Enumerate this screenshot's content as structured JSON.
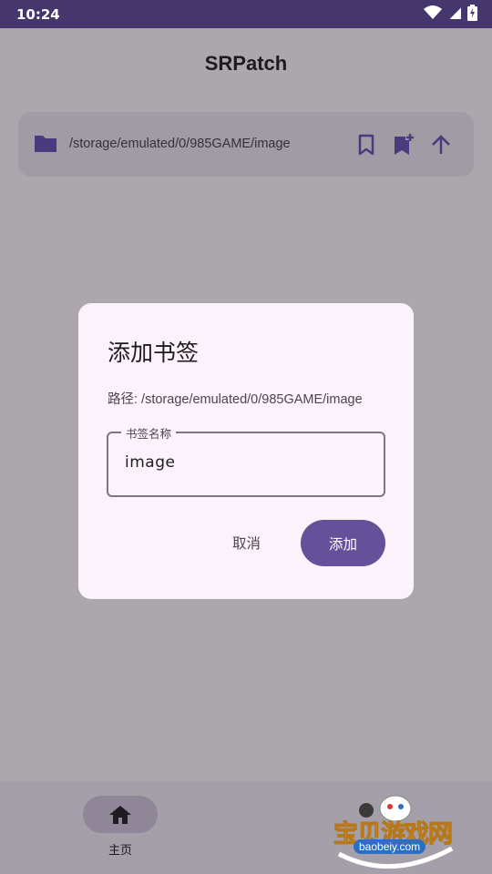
{
  "status_bar": {
    "time": "10:24"
  },
  "app": {
    "title": "SRPatch"
  },
  "path_bar": {
    "path": "/storage/emulated/0/985GAME/image"
  },
  "dialog": {
    "title": "添加书签",
    "path_line": "路径: /storage/emulated/0/985GAME/image",
    "field_label": "书签名称",
    "field_value": "image",
    "cancel_label": "取消",
    "add_label": "添加"
  },
  "bottom_nav": {
    "home_label": "主页"
  },
  "watermark": {
    "text": "宝贝游戏网",
    "url": "baobeiy.com"
  },
  "colors": {
    "accent": "#65509a",
    "status_bar": "#45376e",
    "dialog_bg": "#fbf2fb"
  }
}
